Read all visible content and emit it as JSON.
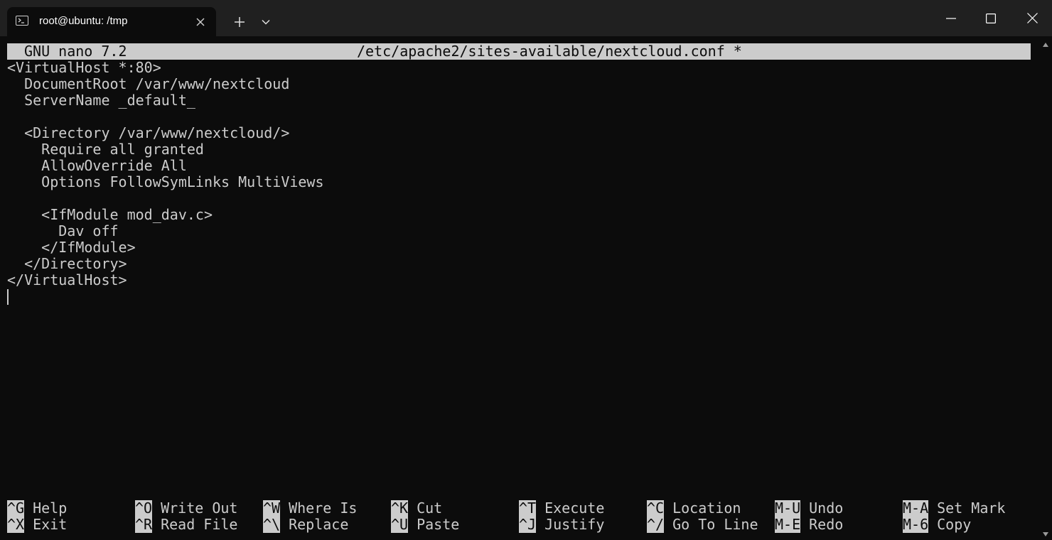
{
  "window": {
    "tab_title": "root@ubuntu: /tmp",
    "buttons": {
      "new_tab": "+",
      "minimize": "minimize-icon",
      "maximize": "maximize-icon",
      "close": "close-icon"
    }
  },
  "nano": {
    "version": "GNU nano 7.2",
    "filename": "/etc/apache2/sites-available/nextcloud.conf *"
  },
  "editor": {
    "lines": [
      "<VirtualHost *:80>",
      "  DocumentRoot /var/www/nextcloud",
      "  ServerName _default_",
      "",
      "  <Directory /var/www/nextcloud/>",
      "    Require all granted",
      "    AllowOverride All",
      "    Options FollowSymLinks MultiViews",
      "",
      "    <IfModule mod_dav.c>",
      "      Dav off",
      "    </IfModule>",
      "  </Directory>",
      "</VirtualHost>"
    ]
  },
  "shortcuts": [
    {
      "key": "^G",
      "label": "Help"
    },
    {
      "key": "^X",
      "label": "Exit"
    },
    {
      "key": "^O",
      "label": "Write Out"
    },
    {
      "key": "^R",
      "label": "Read File"
    },
    {
      "key": "^W",
      "label": "Where Is"
    },
    {
      "key": "^\\",
      "label": "Replace"
    },
    {
      "key": "^K",
      "label": "Cut"
    },
    {
      "key": "^U",
      "label": "Paste"
    },
    {
      "key": "^T",
      "label": "Execute"
    },
    {
      "key": "^J",
      "label": "Justify"
    },
    {
      "key": "^C",
      "label": "Location"
    },
    {
      "key": "^/",
      "label": "Go To Line"
    },
    {
      "key": "M-U",
      "label": "Undo"
    },
    {
      "key": "M-E",
      "label": "Redo"
    },
    {
      "key": "M-A",
      "label": "Set Mark"
    },
    {
      "key": "M-6",
      "label": "Copy"
    }
  ],
  "colors": {
    "terminal_bg": "#0c0c0c",
    "terminal_fg": "#cccccc",
    "titlebar_bg": "#202020"
  }
}
